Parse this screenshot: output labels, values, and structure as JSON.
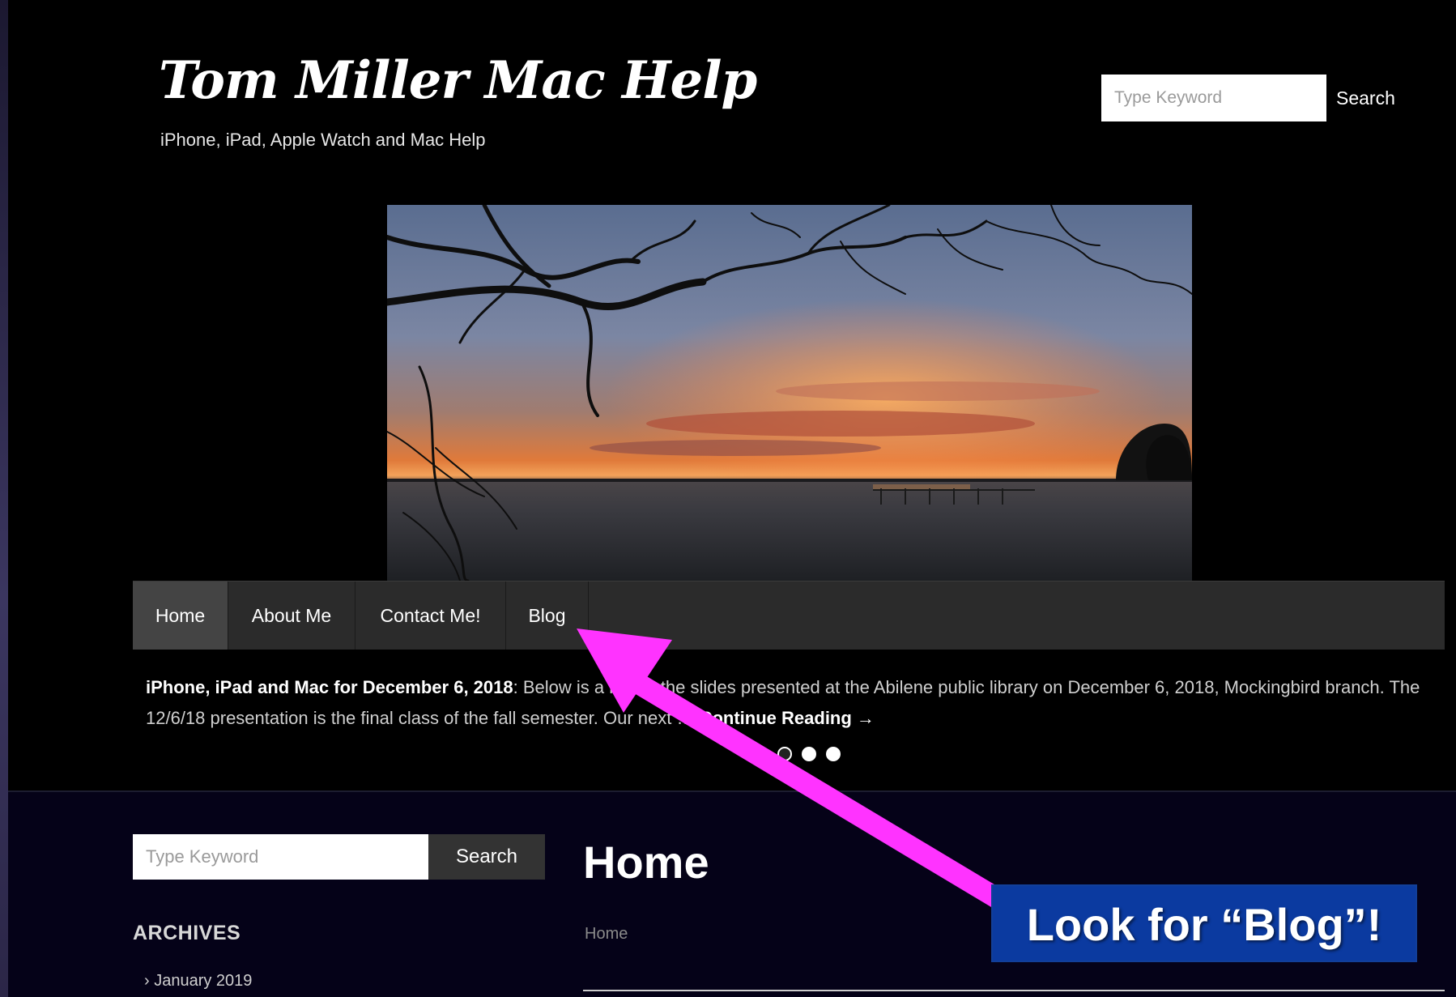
{
  "site": {
    "title": "Tom Miller Mac Help",
    "tagline": "iPhone, iPad, Apple Watch and Mac Help"
  },
  "header_search": {
    "placeholder": "Type Keyword",
    "button_label": "Search"
  },
  "nav": {
    "items": [
      {
        "label": "Home",
        "active": true
      },
      {
        "label": "About Me"
      },
      {
        "label": "Contact Me!"
      },
      {
        "label": "Blog"
      }
    ]
  },
  "featured": {
    "title": "iPhone, iPad and Mac for December 6, 2018",
    "excerpt": ": Below is a link to the slides presented at the Abilene public library on December 6, 2018, Mockingbird branch.   The 12/6/18 presentation is the final class of the fall semester. Our next …",
    "more_label": "Continue Reading →",
    "slides": 4,
    "current_slide": 1
  },
  "sidebar": {
    "search_placeholder": "Type Keyword",
    "search_button": "Search",
    "archives_heading": "ARCHIVES",
    "archives": [
      "January 2019"
    ]
  },
  "main": {
    "heading": "Home",
    "breadcrumb": "Home"
  },
  "annotation": {
    "text": "Look for “Blog”!",
    "arrow_color": "#ff33ff",
    "box_color": "#0b3aa0"
  }
}
